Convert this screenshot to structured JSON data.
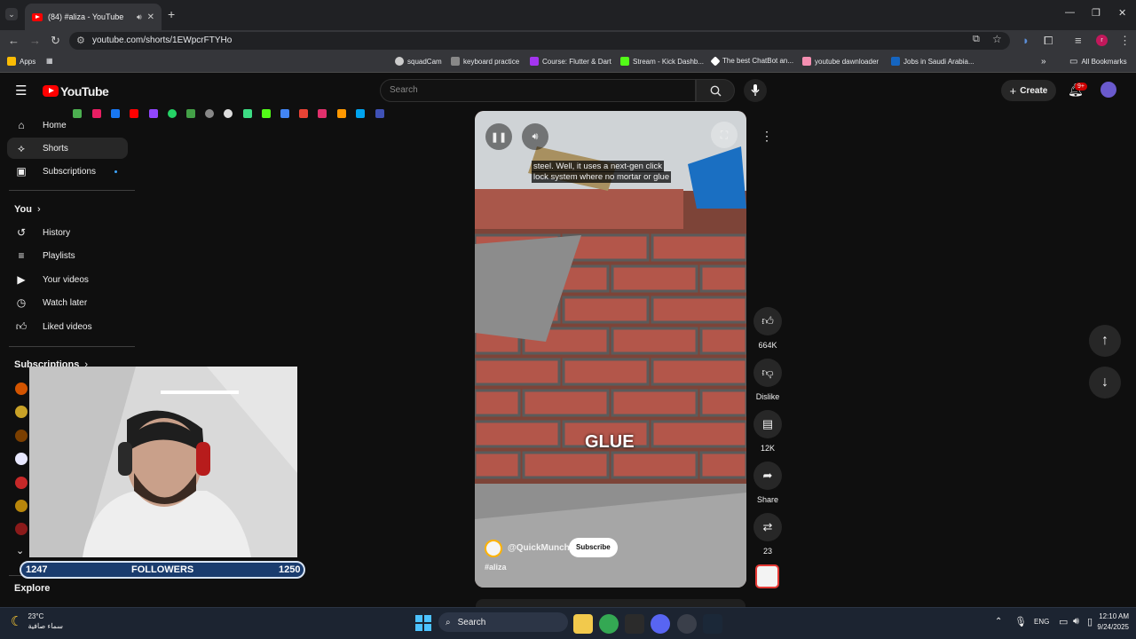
{
  "browser": {
    "tab_title": "(84) #aliza - YouTube",
    "url": "youtube.com/shorts/1EWpcrFTYHo",
    "bookmarks": [
      {
        "label": "Apps"
      },
      {
        "label": "squadCam"
      },
      {
        "label": "keyboard practice"
      },
      {
        "label": "Course: Flutter & Dart"
      },
      {
        "label": "Stream - Kick Dashb..."
      },
      {
        "label": "The best ChatBot an..."
      },
      {
        "label": "youtube dawnloader"
      },
      {
        "label": "Jobs in Saudi Arabia..."
      }
    ],
    "all_bookmarks": "All Bookmarks"
  },
  "header": {
    "logo_text": "YouTube",
    "search_placeholder": "Search",
    "create_label": "Create",
    "notification_badge": "9+"
  },
  "sidebar": {
    "items": [
      {
        "label": "Home",
        "icon": "home-icon"
      },
      {
        "label": "Shorts",
        "icon": "shorts-icon"
      },
      {
        "label": "Subscriptions",
        "icon": "subscriptions-icon"
      }
    ],
    "you_label": "You",
    "you_items": [
      {
        "label": "History",
        "icon": "history-icon"
      },
      {
        "label": "Playlists",
        "icon": "playlists-icon"
      },
      {
        "label": "Your videos",
        "icon": "your-videos-icon"
      },
      {
        "label": "Watch later",
        "icon": "watch-later-icon"
      },
      {
        "label": "Liked videos",
        "icon": "liked-videos-icon"
      }
    ],
    "subscriptions_label": "Subscriptions",
    "explore_label": "Explore"
  },
  "short": {
    "caption_line1": "steel. Well, it uses a next-gen click",
    "caption_line2": "lock system where no mortar or glue",
    "overlay_text": "GLUE",
    "channel": "@QuickMunch.",
    "subscribe_label": "Subscribe",
    "hashtag": "#aliza",
    "likes": "664K",
    "dislike_label": "Dislike",
    "comments": "12K",
    "share_label": "Share",
    "remix_count": "23"
  },
  "stream_overlay": {
    "followers_current": "1247",
    "followers_label": "FOLLOWERS",
    "followers_goal": "1250"
  },
  "taskbar": {
    "weather_temp": "23°C",
    "weather_desc": "سماء صافية",
    "search_label": "Search",
    "lang": "ENG",
    "time": "12:10 AM",
    "date": "9/24/2025"
  }
}
